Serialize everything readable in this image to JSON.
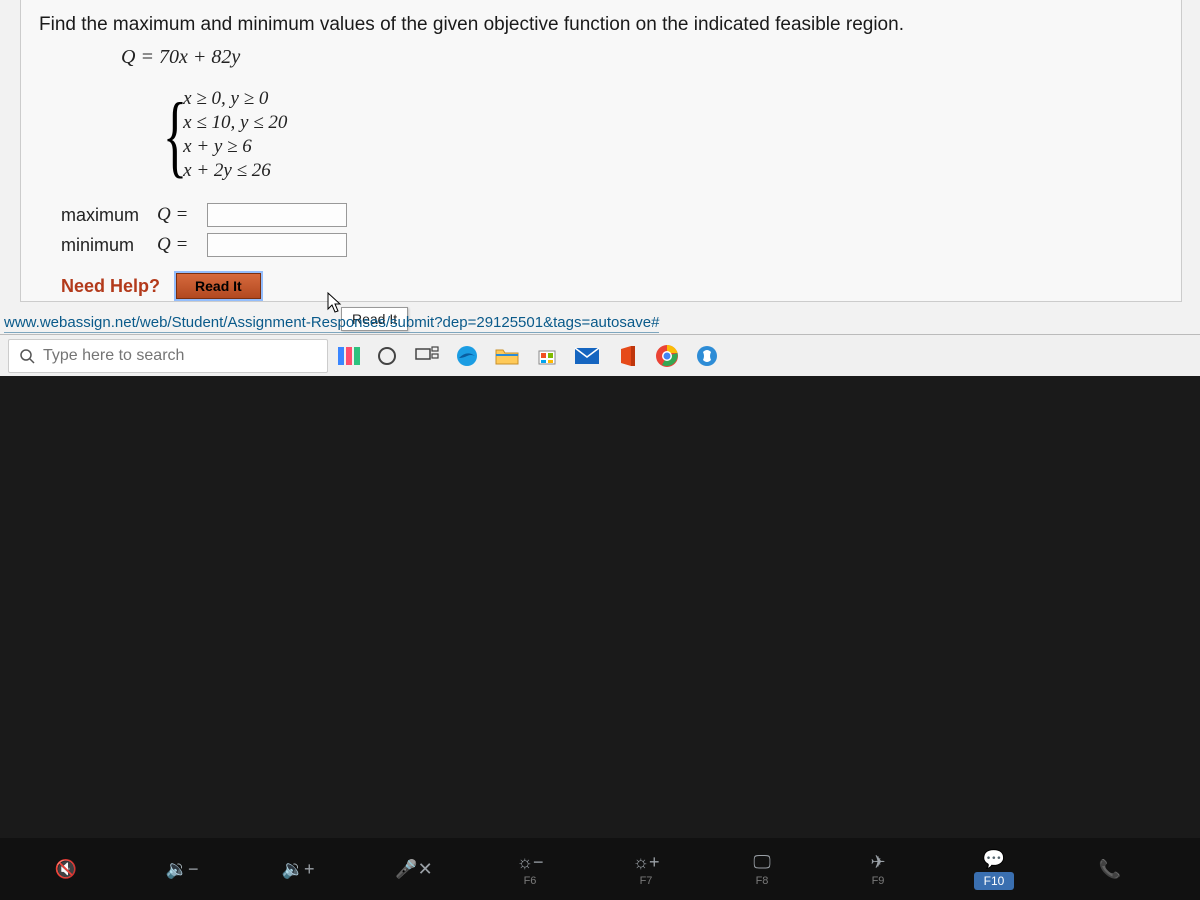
{
  "problem": {
    "prompt": "Find the maximum and minimum values of the given objective function on the indicated feasible region.",
    "objective": "Q = 70x + 82y",
    "constraints": [
      "x ≥ 0, y ≥ 0",
      "x ≤ 10, y ≤ 20",
      "x + y ≥ 6",
      "x + 2y ≤ 26"
    ],
    "answers": {
      "max_label": "maximum",
      "min_label": "minimum",
      "q_eq": "Q =",
      "max_value": "",
      "min_value": ""
    },
    "need_help_label": "Need Help?",
    "readit_label": "Read It",
    "tooltip": "Read It"
  },
  "url": "www.webassign.net/web/Student/Assignment-Responses/submit?dep=29125501&tags=autosave#",
  "search": {
    "placeholder": "Type here to search"
  },
  "fnkeys": {
    "f6": "F6",
    "f7": "F7",
    "f8": "F8",
    "f9": "F9",
    "f10": "F10"
  }
}
